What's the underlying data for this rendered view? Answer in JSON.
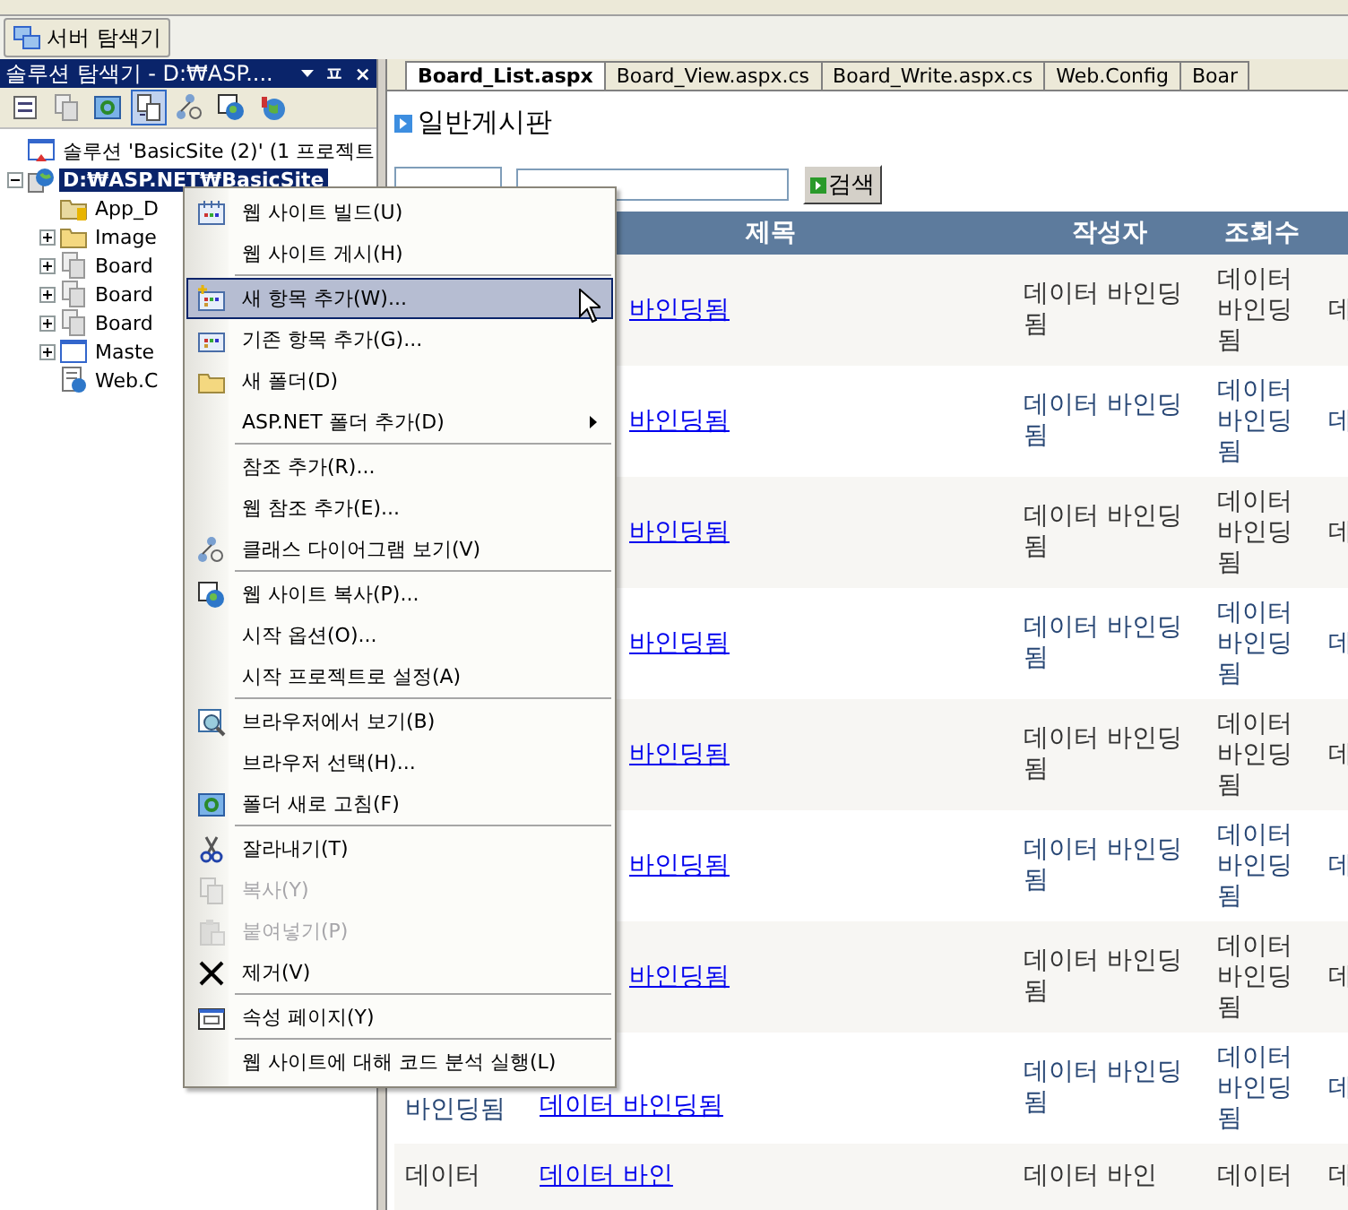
{
  "server_tab": {
    "label": "서버 탐색기"
  },
  "solution_explorer": {
    "title": "솔루션 탐색기 - D:₩ASP....",
    "pin": "ㅍ",
    "close": "×",
    "tools": [
      {
        "kind": "list",
        "selected": false
      },
      {
        "kind": "page",
        "selected": false
      },
      {
        "kind": "refresh",
        "selected": false
      },
      {
        "kind": "files",
        "selected": true
      },
      {
        "kind": "diagram",
        "selected": false
      },
      {
        "kind": "globe-window",
        "selected": false
      },
      {
        "kind": "globe",
        "selected": false
      }
    ],
    "tree": [
      {
        "label": "솔루션 'BasicSite (2)' (1 프로젝트",
        "kind": "solution",
        "selected": false,
        "children": [
          {
            "label": "D:₩ASP.NET₩BasicSite",
            "kind": "web",
            "selected": true,
            "expanded": true,
            "children": [
              {
                "label": "App_D",
                "kind": "app-folder",
                "selected": false
              },
              {
                "label": "Image",
                "kind": "folder",
                "selected": false,
                "expanded": false
              },
              {
                "label": "Board",
                "kind": "page",
                "selected": false,
                "expanded": false
              },
              {
                "label": "Board",
                "kind": "page",
                "selected": false,
                "expanded": false
              },
              {
                "label": "Board",
                "kind": "page",
                "selected": false,
                "expanded": false
              },
              {
                "label": "Maste",
                "kind": "master",
                "selected": false,
                "expanded": false
              },
              {
                "label": "Web.C",
                "kind": "config",
                "selected": false
              }
            ]
          }
        ]
      }
    ]
  },
  "editor": {
    "tabs": [
      {
        "label": "Board_List.aspx",
        "selected": true
      },
      {
        "label": "Board_View.aspx.cs",
        "selected": false
      },
      {
        "label": "Board_Write.aspx.cs",
        "selected": false
      },
      {
        "label": "Web.Config",
        "selected": false
      },
      {
        "label": "Boar",
        "selected": false
      }
    ],
    "heading": "일반게시판",
    "search_button": "검색",
    "table": {
      "columns": [
        "제목",
        "작성자",
        "조회수"
      ],
      "rows": [
        {
          "title": "바인딩됨",
          "kind": "covered",
          "writer": "데이터 바인딩됨",
          "views": "데이터 바인딩됨",
          "column_5": "데"
        },
        {
          "title": "바인딩됨",
          "kind": "covered",
          "writer": "데이터 바인딩됨",
          "views": "데이터 바인딩됨",
          "column_5": "데"
        },
        {
          "title": "바인딩됨",
          "kind": "covered",
          "writer": "데이터 바인딩됨",
          "views": "데이터 바인딩됨",
          "column_5": "데"
        },
        {
          "title": "바인딩됨",
          "kind": "covered",
          "writer": "데이터 바인딩됨",
          "views": "데이터 바인딩됨",
          "column_5": "데"
        },
        {
          "title": "바인딩됨",
          "kind": "covered",
          "writer": "데이터 바인딩됨",
          "views": "데이터 바인딩됨",
          "column_5": "데"
        },
        {
          "title": "바인딩됨",
          "kind": "covered",
          "writer": "데이터 바인딩됨",
          "views": "데이터 바인딩됨",
          "column_5": "데"
        },
        {
          "title": "바인딩됨",
          "kind": "covered",
          "writer": "데이터 바인딩됨",
          "views": "데이터 바인딩됨",
          "column_5": "데"
        },
        {
          "column_1": "바인딩됨",
          "title": "데이터 바인딩됨",
          "kind": "full",
          "writer": "데이터 바인딩됨",
          "views": "데이터 바인딩됨",
          "column_5": "데"
        },
        {
          "column_1": "데이터",
          "title": "데이터 바인",
          "kind": "cut",
          "writer": "데이터 바인",
          "views": "데이터",
          "column_5": "데"
        }
      ]
    }
  },
  "context_menu": {
    "items": [
      {
        "label": "웹 사이트 빌드(U)",
        "kind": "build",
        "selected": false,
        "disabled": false
      },
      {
        "label": "웹 사이트 게시(H)",
        "kind": "plain",
        "selected": false,
        "disabled": false,
        "separator_after": true
      },
      {
        "label": "새 항목 추가(W)...",
        "kind": "new-item",
        "selected": true,
        "disabled": false
      },
      {
        "label": "기존 항목 추가(G)...",
        "kind": "item",
        "selected": false,
        "disabled": false
      },
      {
        "label": "새 폴더(D)",
        "kind": "folder",
        "selected": false,
        "disabled": false
      },
      {
        "label": "ASP.NET 폴더 추가(D)",
        "kind": "plain",
        "selected": false,
        "disabled": false,
        "submenu": true,
        "separator_after": true
      },
      {
        "label": "참조 추가(R)...",
        "kind": "plain",
        "selected": false,
        "disabled": false
      },
      {
        "label": "웹 참조 추가(E)...",
        "kind": "plain",
        "selected": false,
        "disabled": false
      },
      {
        "label": "클래스 다이어그램 보기(V)",
        "kind": "diagram",
        "selected": false,
        "disabled": false,
        "separator_after": true
      },
      {
        "label": "웹 사이트 복사(P)...",
        "kind": "globe-window",
        "selected": false,
        "disabled": false
      },
      {
        "label": "시작 옵션(O)...",
        "kind": "plain",
        "selected": false,
        "disabled": false
      },
      {
        "label": "시작 프로젝트로 설정(A)",
        "kind": "plain",
        "selected": false,
        "disabled": false,
        "separator_after": true
      },
      {
        "label": "브라우저에서 보기(B)",
        "kind": "magnifier",
        "selected": false,
        "disabled": false
      },
      {
        "label": "브라우저 선택(H)...",
        "kind": "plain",
        "selected": false,
        "disabled": false
      },
      {
        "label": "폴더 새로 고침(F)",
        "kind": "refresh",
        "selected": false,
        "disabled": false,
        "separator_after": true
      },
      {
        "label": "잘라내기(T)",
        "kind": "scissors",
        "selected": false,
        "disabled": false
      },
      {
        "label": "복사(Y)",
        "kind": "copy",
        "selected": false,
        "disabled": true
      },
      {
        "label": "붙여넣기(P)",
        "kind": "paste",
        "selected": false,
        "disabled": true
      },
      {
        "label": "제거(V)",
        "kind": "remove",
        "selected": false,
        "disabled": false,
        "separator_after": true
      },
      {
        "label": "속성 페이지(Y)",
        "kind": "properties",
        "selected": false,
        "disabled": false,
        "separator_after": true
      },
      {
        "label": "웹 사이트에 대해 코드 분석 실행(L)",
        "kind": "plain",
        "selected": false,
        "disabled": false
      }
    ]
  }
}
